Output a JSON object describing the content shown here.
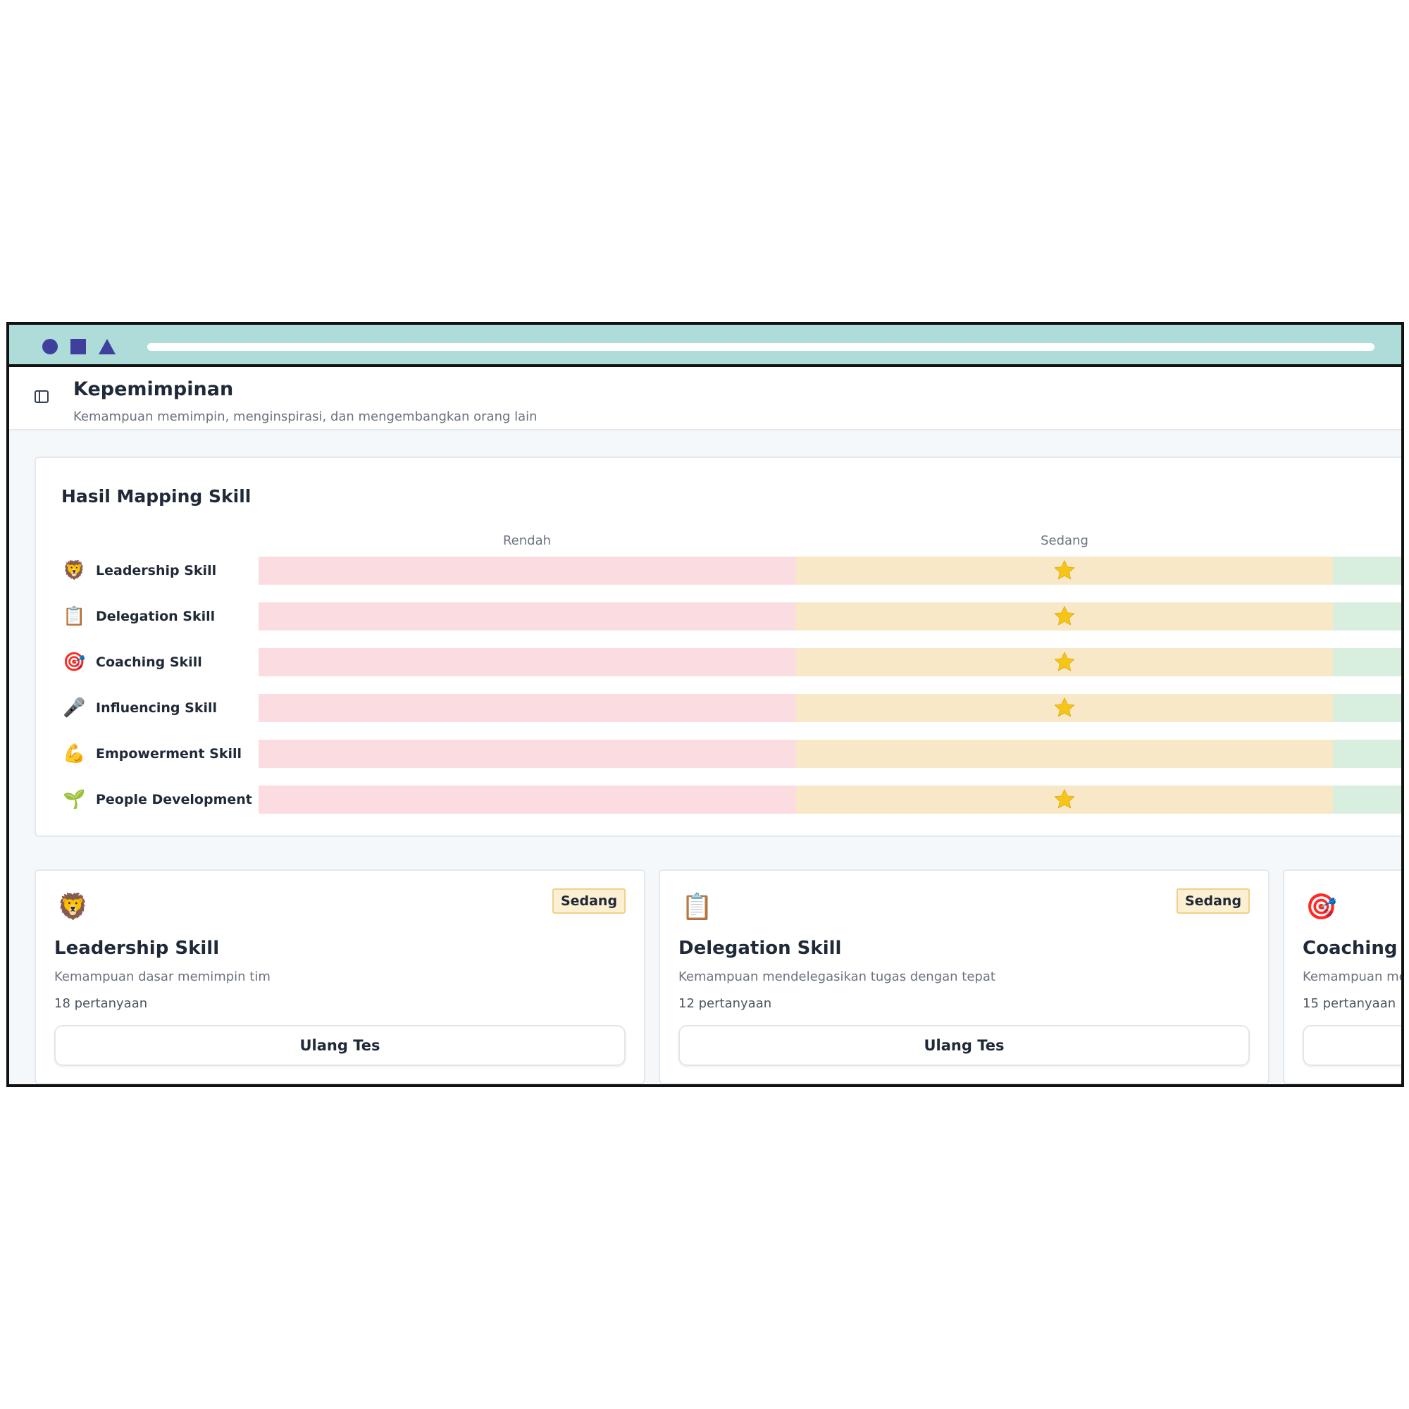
{
  "header": {
    "title": "Kepemimpinan",
    "subtitle": "Kemampuan memimpin, menginspirasi, dan mengembangkan orang lain"
  },
  "mapping": {
    "title": "Hasil Mapping Skill",
    "levels": [
      "Rendah",
      "Sedang"
    ],
    "rows": [
      {
        "icon": "lion-icon",
        "label": "Leadership Skill",
        "level": "Sedang",
        "rated": true
      },
      {
        "icon": "clipboard-icon",
        "label": "Delegation Skill",
        "level": "Sedang",
        "rated": true
      },
      {
        "icon": "target-icon",
        "label": "Coaching Skill",
        "level": "Sedang",
        "rated": true
      },
      {
        "icon": "microphone-icon",
        "label": "Influencing Skill",
        "level": "Sedang",
        "rated": true
      },
      {
        "icon": "flexed-biceps-icon",
        "label": "Empowerment Skill",
        "level": "",
        "rated": false
      },
      {
        "icon": "seedling-icon",
        "label": "People Development",
        "level": "Sedang",
        "rated": true
      }
    ],
    "colors": {
      "low": "#fbdde1",
      "medium": "#f8e8c8",
      "high": "#d8efe0",
      "star": "#f5c518"
    }
  },
  "cards": [
    {
      "icon": "lion-icon",
      "badge": "Sedang",
      "title": "Leadership Skill",
      "description": "Kemampuan dasar memimpin tim",
      "count": "18 pertanyaan",
      "button": "Ulang Tes"
    },
    {
      "icon": "clipboard-icon",
      "badge": "Sedang",
      "title": "Delegation Skill",
      "description": "Kemampuan mendelegasikan tugas dengan tepat",
      "count": "12 pertanyaan",
      "button": "Ulang Tes"
    },
    {
      "icon": "target-icon",
      "badge": "",
      "title": "Coaching Sk",
      "description": "Kemampuan mel",
      "count": "15 pertanyaan",
      "button": ""
    }
  ]
}
